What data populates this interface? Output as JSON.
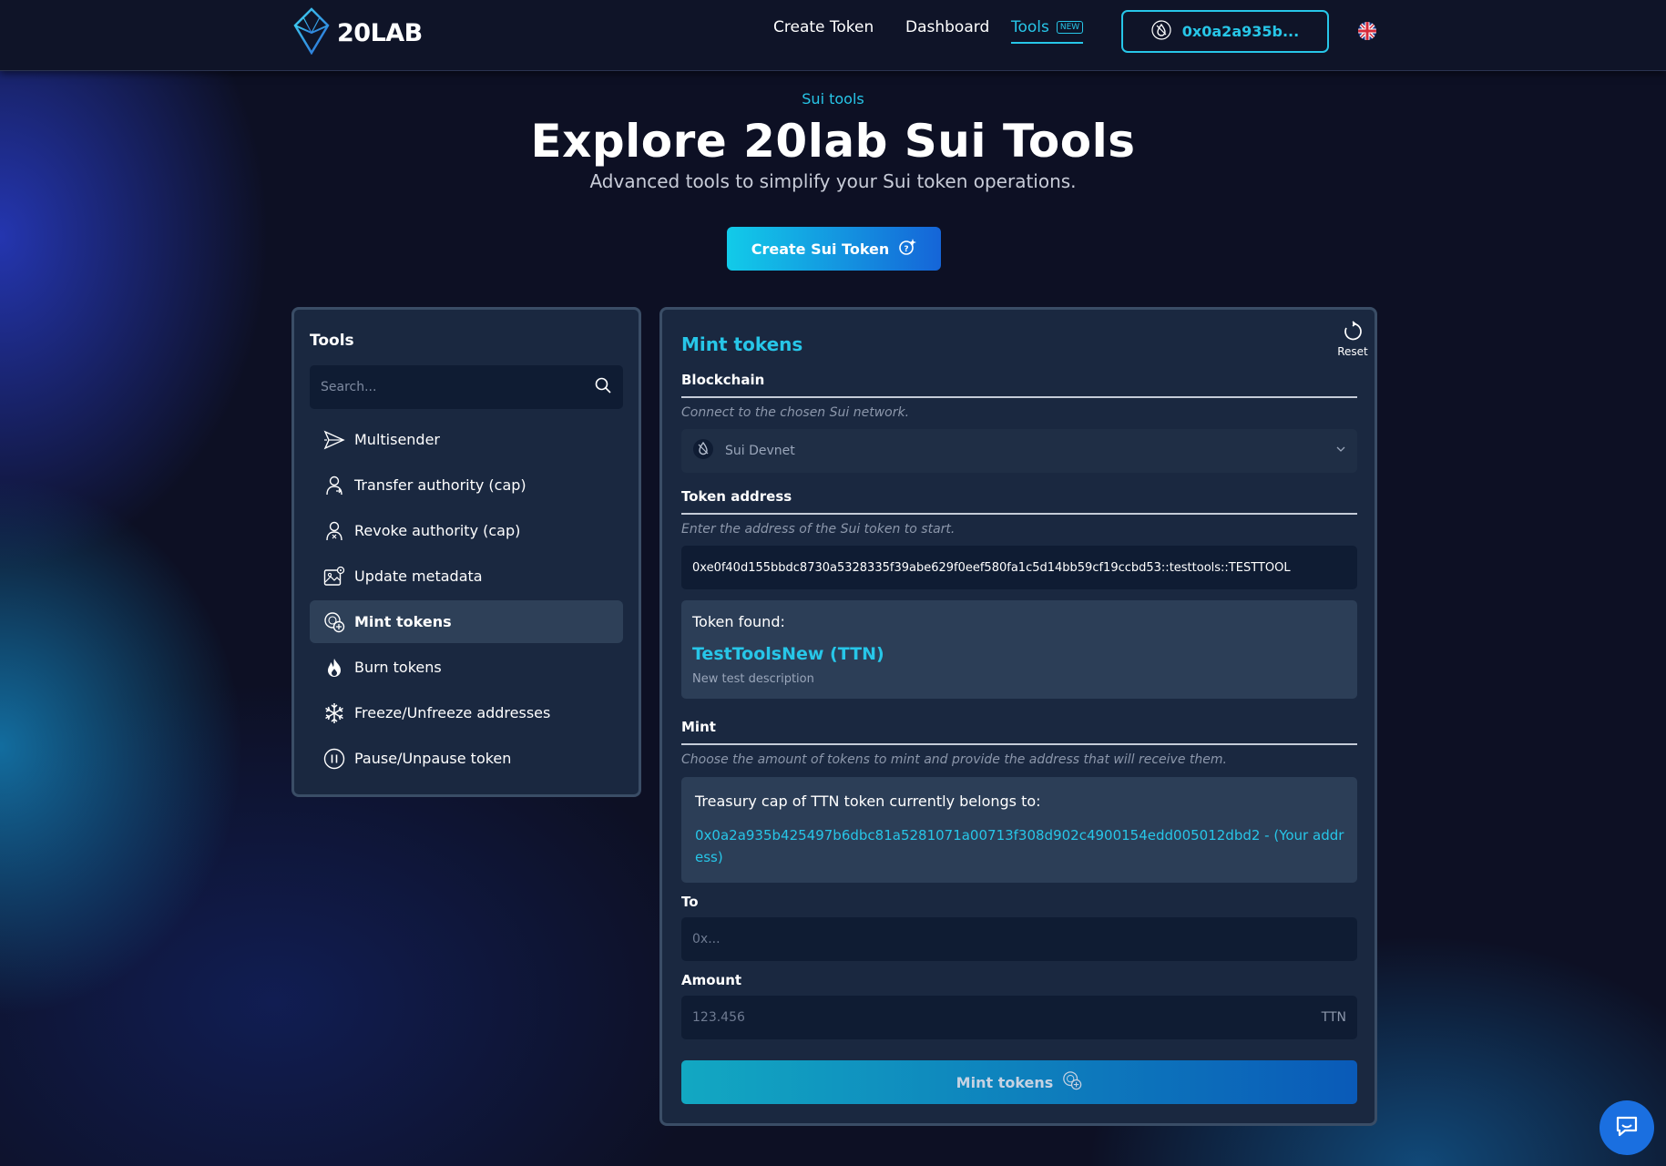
{
  "header": {
    "brand": "20LAB",
    "nav": {
      "create_token": "Create Token",
      "dashboard": "Dashboard",
      "tools": "Tools",
      "tools_badge": "NEW"
    },
    "wallet_address": "0x0a2a935b...",
    "language_icon": "uk-flag-icon"
  },
  "hero": {
    "eyebrow": "Sui tools",
    "title": "Explore 20lab Sui Tools",
    "subtitle": "Advanced tools to simplify your Sui token operations.",
    "cta_label": "Create Sui Token"
  },
  "tools_panel": {
    "title": "Tools",
    "search_placeholder": "Search...",
    "items": [
      {
        "label": "Multisender",
        "icon": "send-icon"
      },
      {
        "label": "Transfer authority (cap)",
        "icon": "person-arrow-icon"
      },
      {
        "label": "Revoke authority (cap)",
        "icon": "person-x-icon"
      },
      {
        "label": "Update metadata",
        "icon": "image-gear-icon"
      },
      {
        "label": "Mint tokens",
        "icon": "coins-plus-icon",
        "active": true
      },
      {
        "label": "Burn tokens",
        "icon": "flame-icon"
      },
      {
        "label": "Freeze/Unfreeze addresses",
        "icon": "snowflake-icon"
      },
      {
        "label": "Pause/Unpause token",
        "icon": "pause-icon"
      }
    ]
  },
  "main": {
    "title": "Mint tokens",
    "reset_label": "Reset",
    "blockchain": {
      "label": "Blockchain",
      "help": "Connect to the chosen Sui network.",
      "selected": "Sui Devnet"
    },
    "token_address": {
      "label": "Token address",
      "help": "Enter the address of the Sui token to start.",
      "value": "0xe0f40d155bbdc8730a5328335f39abe629f0eef580fa1c5d14bb59cf19ccbd53::testtools::TESTTOOL"
    },
    "token_found": {
      "label": "Token found:",
      "name": "TestToolsNew (TTN)",
      "description": "New test description"
    },
    "mint": {
      "label": "Mint",
      "help": "Choose the amount of tokens to mint and provide the address that will receive them.",
      "treasury_label": "Treasury cap of TTN token currently belongs to:",
      "treasury_address": "0x0a2a935b425497b6dbc81a5281071a00713f308d902c4900154edd005012dbd2 - (Your address)"
    },
    "to": {
      "label": "To",
      "placeholder": "0x..."
    },
    "amount": {
      "label": "Amount",
      "placeholder": "123.456",
      "suffix": "TTN"
    },
    "submit_label": "Mint tokens"
  },
  "colors": {
    "accent": "#27c6e8",
    "panel": "#1a2840",
    "panel_border": "#3a4d66",
    "input_bg": "#0f1c33"
  }
}
